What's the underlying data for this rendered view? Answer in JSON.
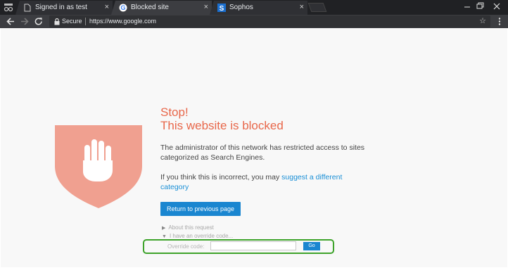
{
  "browser": {
    "tabs": [
      {
        "label": "Signed in as test",
        "favicon": "page-icon",
        "active": false
      },
      {
        "label": "Blocked site",
        "favicon": "google-icon",
        "active": true
      },
      {
        "label": "Sophos",
        "favicon": "sophos-icon",
        "active": false
      }
    ],
    "tab_close_glyph": "×",
    "toolbar": {
      "secure_label": "Secure",
      "url": "https://www.google.com",
      "bookmark_glyph": "☆"
    }
  },
  "block_page": {
    "title_line1": "Stop!",
    "title_line2": "This website is blocked",
    "paragraph1_line1": "The administrator of this network has restricted access to sites",
    "paragraph1_line2": "categorized as Search Engines.",
    "paragraph2_prefix": "If you think this is incorrect, you may",
    "paragraph2_link_part1": "suggest a different",
    "paragraph2_link_part2": "category",
    "return_button": "Return to previous page",
    "about_request": "About this request",
    "override_toggle": "I have an override code...",
    "override_label": "Override code:",
    "override_value": "",
    "go_button": "Go"
  },
  "colors": {
    "accent_red": "#e8674a",
    "shield": "#f0a090",
    "button_blue": "#1a86d0",
    "link_blue": "#1a8fd6",
    "highlight_green": "#3ea32b"
  }
}
